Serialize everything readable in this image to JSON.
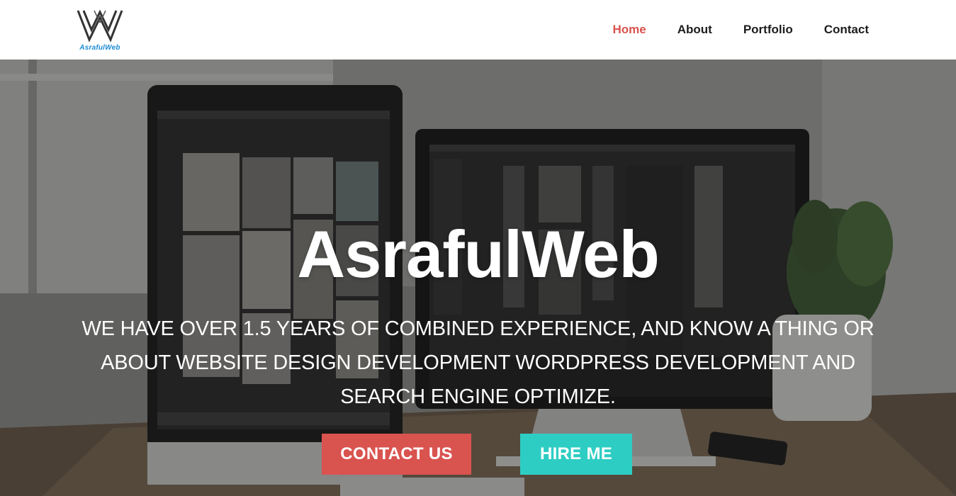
{
  "brand": {
    "logo_text": "AsrafulWeb",
    "logo_icon": "w-monogram-icon"
  },
  "nav": {
    "items": [
      {
        "label": "Home",
        "active": true
      },
      {
        "label": "About",
        "active": false
      },
      {
        "label": "Portfolio",
        "active": false
      },
      {
        "label": "Contact",
        "active": false
      }
    ]
  },
  "hero": {
    "title": "AsrafulWeb",
    "description": "WE HAVE OVER 1.5 YEARS OF COMBINED EXPERIENCE, AND KNOW A THING OR ABOUT WEBSITE DESIGN DEVELOPMENT WORDPRESS DEVELOPMENT AND SEARCH ENGINE OPTIMIZE.",
    "buttons": {
      "contact_label": "CONTACT US",
      "hire_label": "HIRE ME"
    }
  },
  "colors": {
    "accent_red": "#d9534f",
    "accent_teal": "#2ecdc3",
    "logo_blue": "#1b8bd6",
    "nav_text": "#1d1d1d"
  }
}
